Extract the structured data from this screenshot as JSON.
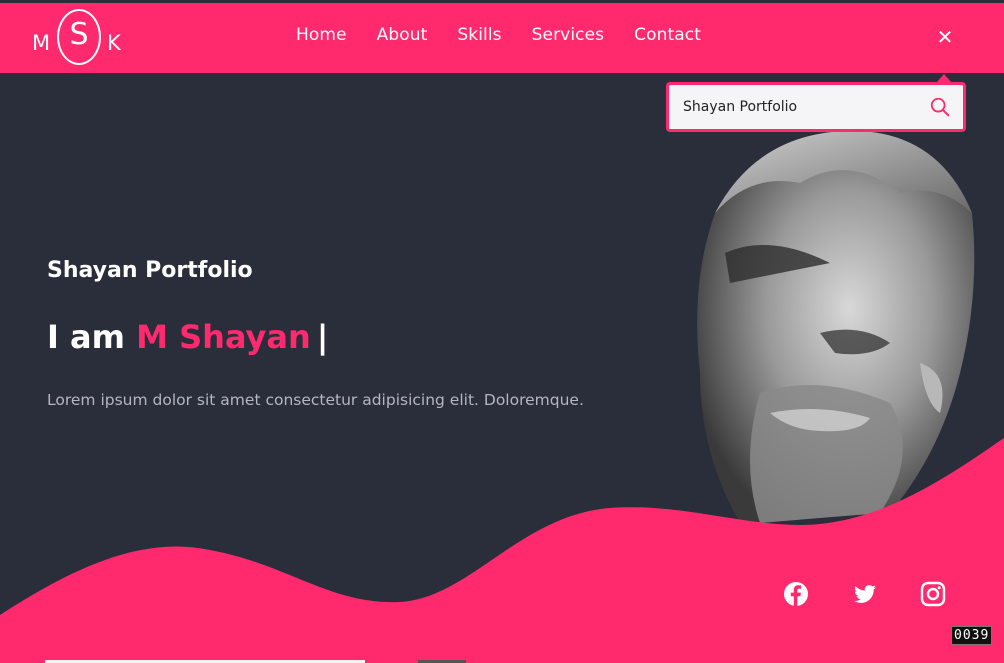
{
  "logo": {
    "left": "M",
    "center": "S",
    "right": "K"
  },
  "nav": {
    "links": [
      "Home",
      "About",
      "Skills",
      "Services",
      "Contact"
    ],
    "close_icon": "close-icon"
  },
  "search": {
    "value": "Shayan Portfolio",
    "icon": "search-icon"
  },
  "hero": {
    "subtitle": "Shayan Portfolio",
    "title_prefix": "I am",
    "title_name": "M Shayan",
    "title_cursor": "|",
    "description": "Lorem ipsum dolor sit amet consectetur adipisicing elit. Doloremque."
  },
  "socials": [
    "facebook-icon",
    "twitter-icon",
    "instagram-icon"
  ],
  "counter": "0039",
  "colors": {
    "accent": "#ff2a6d",
    "background": "#2a2d3a",
    "text": "#ffffff",
    "muted_text": "#b5b6bf"
  }
}
